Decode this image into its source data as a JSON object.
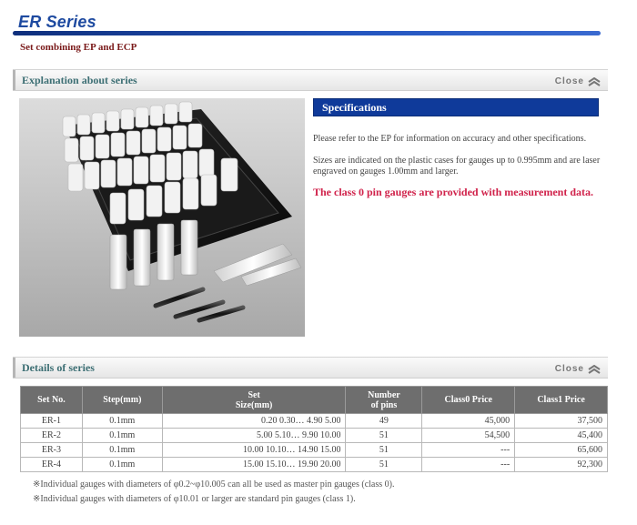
{
  "header": {
    "title": "ER Series",
    "subtitle": "Set combining EP and ECP"
  },
  "explanation": {
    "title": "Explanation about series",
    "close_label": "Close"
  },
  "specifications": {
    "title": "Specifications",
    "line1": "Please refer to the EP for information on accuracy and other specifications.",
    "line2a": "Sizes are indicated on the plastic cases for gauges up to 0.995mm and are laser",
    "line2b": "engraved on gauges 1.00mm and larger.",
    "highlight": "The class 0 pin gauges are provided with measurement data."
  },
  "details": {
    "title": "Details of series",
    "close_label": "Close",
    "headers": {
      "set_no": "Set No.",
      "step": "Step(mm)",
      "set_size_1": "Set",
      "set_size_2": "Size(mm)",
      "num_pins_1": "Number",
      "num_pins_2": "of pins",
      "class0": "Class0 Price",
      "class1": "Class1 Price"
    },
    "rows": [
      {
        "set_no": "ER-1",
        "step": "0.1mm",
        "size": "0.20 0.30… 4.90 5.00",
        "pins": "49",
        "class0": "45,000",
        "class1": "37,500"
      },
      {
        "set_no": "ER-2",
        "step": "0.1mm",
        "size": "5.00 5.10… 9.90 10.00",
        "pins": "51",
        "class0": "54,500",
        "class1": "45,400"
      },
      {
        "set_no": "ER-3",
        "step": "0.1mm",
        "size": "10.00 10.10… 14.90 15.00",
        "pins": "51",
        "class0": "---",
        "class1": "65,600"
      },
      {
        "set_no": "ER-4",
        "step": "0.1mm",
        "size": "15.00 15.10… 19.90 20.00",
        "pins": "51",
        "class0": "---",
        "class1": "92,300"
      }
    ],
    "notes": [
      "※Individual gauges with diameters of φ0.2~φ10.005 can all be used as master pin gauges (class 0).",
      "※Individual gauges with diameters of φ10.01 or larger are standard pin gauges (class 1)."
    ]
  },
  "icons": {
    "close": "chevron-double-up-icon"
  }
}
